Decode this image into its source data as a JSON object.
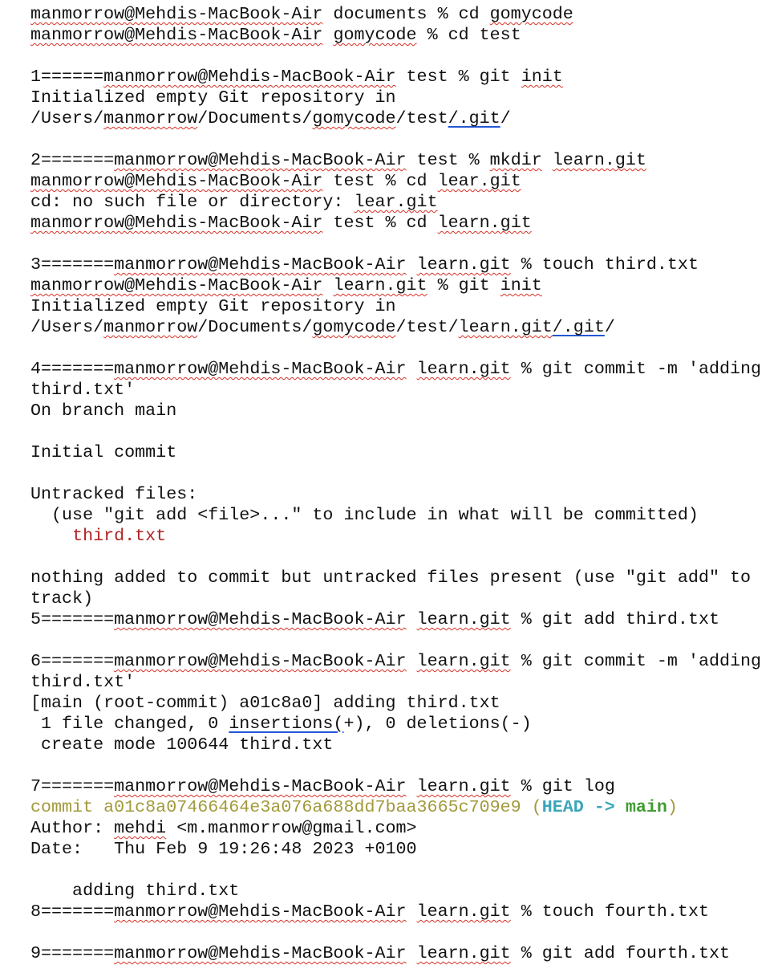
{
  "colors": {
    "spell_underline": "#d93025",
    "link_underline": "#2457d6",
    "untracked_file": "#b22222",
    "commit_hash": "#a29a3c",
    "head_ref": "#3aa6b9",
    "branch_ref": "#3f9d2f"
  },
  "lines": [
    {
      "segs": [
        {
          "t": "manmorrow@Mehdis-MacBook-Air",
          "s": "sp"
        },
        {
          "t": " documents % cd "
        },
        {
          "t": "gomycode",
          "s": "sp"
        }
      ]
    },
    {
      "segs": [
        {
          "t": "manmorrow@Mehdis-MacBook-Air",
          "s": "sp"
        },
        {
          "t": " "
        },
        {
          "t": "gomycode",
          "s": "sp"
        },
        {
          "t": " % cd test"
        }
      ]
    },
    {
      "blank": true
    },
    {
      "segs": [
        {
          "t": "1======"
        },
        {
          "t": "manmorrow@Mehdis-MacBook-Air",
          "s": "sp"
        },
        {
          "t": " test % git "
        },
        {
          "t": "init",
          "s": "sp"
        }
      ]
    },
    {
      "segs": [
        {
          "t": "Initialized empty Git repository in"
        }
      ]
    },
    {
      "segs": [
        {
          "t": "/Users/"
        },
        {
          "t": "manmorrow",
          "s": "sp"
        },
        {
          "t": "/Documents/"
        },
        {
          "t": "gomycode",
          "s": "sp"
        },
        {
          "t": "/test"
        },
        {
          "t": "/.git",
          "s": "ul"
        },
        {
          "t": "/"
        }
      ]
    },
    {
      "blank": true
    },
    {
      "segs": [
        {
          "t": "2======="
        },
        {
          "t": "manmorrow@Mehdis-MacBook-Air",
          "s": "sp"
        },
        {
          "t": " test % "
        },
        {
          "t": "mkdir",
          "s": "sp"
        },
        {
          "t": " "
        },
        {
          "t": "learn.git",
          "s": "sp"
        }
      ]
    },
    {
      "segs": [
        {
          "t": "manmorrow@Mehdis-MacBook-Air",
          "s": "sp"
        },
        {
          "t": " test % cd "
        },
        {
          "t": "lear.git",
          "s": "sp"
        }
      ]
    },
    {
      "segs": [
        {
          "t": "cd: no such file or directory: "
        },
        {
          "t": "lear.git",
          "s": "sp"
        }
      ]
    },
    {
      "segs": [
        {
          "t": "manmorrow@Mehdis-MacBook-Air",
          "s": "sp"
        },
        {
          "t": " test % cd "
        },
        {
          "t": "learn.git",
          "s": "sp"
        }
      ]
    },
    {
      "blank": true
    },
    {
      "segs": [
        {
          "t": "3======="
        },
        {
          "t": "manmorrow@Mehdis-MacBook-Air",
          "s": "sp"
        },
        {
          "t": " "
        },
        {
          "t": "learn.git",
          "s": "sp"
        },
        {
          "t": " % touch third.txt"
        }
      ]
    },
    {
      "segs": [
        {
          "t": "manmorrow@Mehdis-MacBook-Air",
          "s": "sp"
        },
        {
          "t": " "
        },
        {
          "t": "learn.git",
          "s": "sp"
        },
        {
          "t": " % git "
        },
        {
          "t": "init",
          "s": "sp"
        }
      ]
    },
    {
      "segs": [
        {
          "t": "Initialized empty Git repository in"
        }
      ]
    },
    {
      "segs": [
        {
          "t": "/Users/"
        },
        {
          "t": "manmorrow",
          "s": "sp"
        },
        {
          "t": "/Documents/"
        },
        {
          "t": "gomycode",
          "s": "sp"
        },
        {
          "t": "/test/"
        },
        {
          "t": "learn.git",
          "s": "sp"
        },
        {
          "t": "/.git",
          "s": "ul"
        },
        {
          "t": "/"
        }
      ]
    },
    {
      "blank": true
    },
    {
      "segs": [
        {
          "t": "4======="
        },
        {
          "t": "manmorrow@Mehdis-MacBook-Air",
          "s": "sp"
        },
        {
          "t": " "
        },
        {
          "t": "learn.git",
          "s": "sp"
        },
        {
          "t": " % git commit -m 'adding"
        }
      ]
    },
    {
      "segs": [
        {
          "t": "third.txt'"
        }
      ]
    },
    {
      "segs": [
        {
          "t": "On branch main"
        }
      ]
    },
    {
      "blank": true
    },
    {
      "segs": [
        {
          "t": "Initial commit"
        }
      ]
    },
    {
      "blank": true
    },
    {
      "segs": [
        {
          "t": "Untracked files:"
        }
      ]
    },
    {
      "segs": [
        {
          "t": "  (use \"git add <file>...\" to include in what will be committed)"
        }
      ]
    },
    {
      "segs": [
        {
          "t": "    "
        },
        {
          "t": "third.txt",
          "s": "red"
        }
      ]
    },
    {
      "blank": true
    },
    {
      "segs": [
        {
          "t": "nothing added to commit but untracked files present (use \"git add\" to"
        }
      ]
    },
    {
      "segs": [
        {
          "t": "track)"
        }
      ]
    },
    {
      "segs": [
        {
          "t": "5======="
        },
        {
          "t": "manmorrow@Mehdis-MacBook-Air",
          "s": "sp"
        },
        {
          "t": " "
        },
        {
          "t": "learn.git",
          "s": "sp"
        },
        {
          "t": " % git add third.txt"
        }
      ]
    },
    {
      "blank": true
    },
    {
      "segs": [
        {
          "t": "6======="
        },
        {
          "t": "manmorrow@Mehdis-MacBook-Air",
          "s": "sp"
        },
        {
          "t": " "
        },
        {
          "t": "learn.git",
          "s": "sp"
        },
        {
          "t": " % git commit -m 'adding"
        }
      ]
    },
    {
      "segs": [
        {
          "t": "third.txt'"
        }
      ]
    },
    {
      "segs": [
        {
          "t": "[main (root-commit) a01c8a0] adding third.txt"
        }
      ]
    },
    {
      "segs": [
        {
          "t": " 1 file changed, 0 "
        },
        {
          "t": "insertions(",
          "s": "ul"
        },
        {
          "t": "+), 0 deletions(-)"
        }
      ]
    },
    {
      "segs": [
        {
          "t": " create mode 100644 third.txt"
        }
      ]
    },
    {
      "blank": true
    },
    {
      "segs": [
        {
          "t": "7======="
        },
        {
          "t": "manmorrow@Mehdis-MacBook-Air",
          "s": "sp"
        },
        {
          "t": " "
        },
        {
          "t": "learn.git",
          "s": "sp"
        },
        {
          "t": " % git log"
        }
      ]
    },
    {
      "segs": [
        {
          "t": "commit a01c8a07466464e3a076a688dd7baa3665c709e9 (",
          "s": "olive"
        },
        {
          "t": "HEAD -> ",
          "s": "cyan"
        },
        {
          "t": "main",
          "s": "green"
        },
        {
          "t": ")",
          "s": "olive"
        }
      ]
    },
    {
      "segs": [
        {
          "t": "Author: "
        },
        {
          "t": "mehdi",
          "s": "sp"
        },
        {
          "t": " <m.manmorrow@gmail.com>"
        }
      ]
    },
    {
      "segs": [
        {
          "t": "Date:   Thu Feb 9 19:26:48 2023 +0100"
        }
      ]
    },
    {
      "blank": true
    },
    {
      "segs": [
        {
          "t": "    adding third.txt"
        }
      ]
    },
    {
      "segs": [
        {
          "t": "8======="
        },
        {
          "t": "manmorrow@Mehdis-MacBook-Air",
          "s": "sp"
        },
        {
          "t": " "
        },
        {
          "t": "learn.git",
          "s": "sp"
        },
        {
          "t": " % touch fourth.txt"
        }
      ]
    },
    {
      "blank": true
    },
    {
      "segs": [
        {
          "t": "9======="
        },
        {
          "t": "manmorrow@Mehdis-MacBook-Air",
          "s": "sp"
        },
        {
          "t": " "
        },
        {
          "t": "learn.git",
          "s": "sp"
        },
        {
          "t": " % git add fourth.txt"
        }
      ]
    }
  ]
}
